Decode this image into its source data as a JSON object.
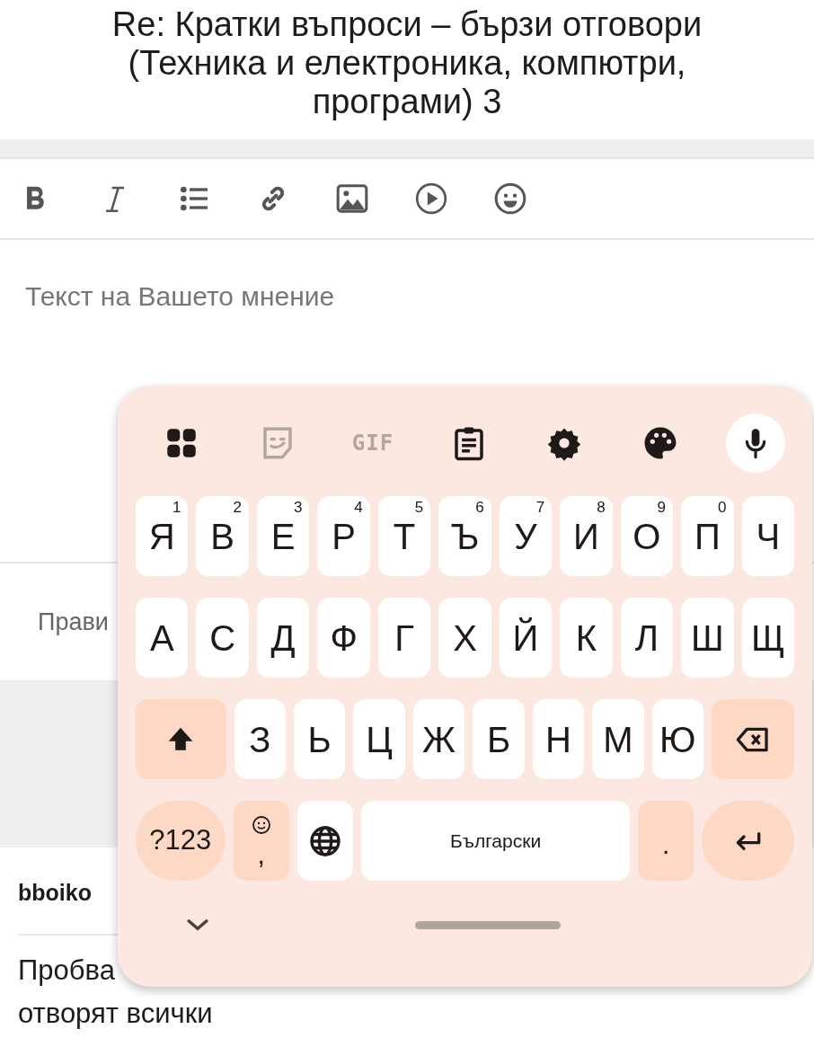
{
  "thread_title": "Re: Кратки въпроси – бързи отговори (Техника и електроника, компютри, програми) 3",
  "editor": {
    "toolbar": [
      {
        "kind": "bold"
      },
      {
        "kind": "italic"
      },
      {
        "kind": "list"
      },
      {
        "kind": "link"
      },
      {
        "kind": "image"
      },
      {
        "kind": "video"
      },
      {
        "kind": "emoji"
      }
    ],
    "placeholder": "Текст на Вашето мнение"
  },
  "below_editor_text": "Прави",
  "post": {
    "author": "bboiko",
    "body_visible": "Пробва",
    "body_last_line": "отворят всички"
  },
  "keyboard": {
    "toolbar": [
      {
        "kind": "apps"
      },
      {
        "kind": "sticker"
      },
      {
        "kind": "gif",
        "label": "GIF"
      },
      {
        "kind": "clipboard"
      },
      {
        "kind": "settings"
      },
      {
        "kind": "palette"
      },
      {
        "kind": "mic"
      }
    ],
    "rows": [
      {
        "keys": [
          {
            "kind": "letter",
            "label": "Я",
            "hint": "1"
          },
          {
            "kind": "letter",
            "label": "В",
            "hint": "2"
          },
          {
            "kind": "letter",
            "label": "Е",
            "hint": "3"
          },
          {
            "kind": "letter",
            "label": "Р",
            "hint": "4"
          },
          {
            "kind": "letter",
            "label": "Т",
            "hint": "5"
          },
          {
            "kind": "letter",
            "label": "Ъ",
            "hint": "6"
          },
          {
            "kind": "letter",
            "label": "У",
            "hint": "7"
          },
          {
            "kind": "letter",
            "label": "И",
            "hint": "8"
          },
          {
            "kind": "letter",
            "label": "О",
            "hint": "9"
          },
          {
            "kind": "letter",
            "label": "П",
            "hint": "0"
          },
          {
            "kind": "letter",
            "label": "Ч"
          }
        ]
      },
      {
        "keys": [
          {
            "kind": "letter",
            "label": "А"
          },
          {
            "kind": "letter",
            "label": "С"
          },
          {
            "kind": "letter",
            "label": "Д"
          },
          {
            "kind": "letter",
            "label": "Ф"
          },
          {
            "kind": "letter",
            "label": "Г"
          },
          {
            "kind": "letter",
            "label": "Х"
          },
          {
            "kind": "letter",
            "label": "Й"
          },
          {
            "kind": "letter",
            "label": "К"
          },
          {
            "kind": "letter",
            "label": "Л"
          },
          {
            "kind": "letter",
            "label": "Ш"
          },
          {
            "kind": "letter",
            "label": "Щ"
          }
        ]
      },
      {
        "keys": [
          {
            "kind": "shift"
          },
          {
            "kind": "letter",
            "label": "З"
          },
          {
            "kind": "letter",
            "label": "Ь"
          },
          {
            "kind": "letter",
            "label": "Ц"
          },
          {
            "kind": "letter",
            "label": "Ж"
          },
          {
            "kind": "letter",
            "label": "Б"
          },
          {
            "kind": "letter",
            "label": "Н"
          },
          {
            "kind": "letter",
            "label": "М"
          },
          {
            "kind": "letter",
            "label": "Ю"
          },
          {
            "kind": "backspace"
          }
        ]
      },
      {
        "keys": [
          {
            "kind": "symbols",
            "label": "?123"
          },
          {
            "kind": "comma",
            "label": ","
          },
          {
            "kind": "globe"
          },
          {
            "kind": "space",
            "label": "Български"
          },
          {
            "kind": "period",
            "label": "."
          },
          {
            "kind": "enter"
          }
        ]
      }
    ]
  }
}
